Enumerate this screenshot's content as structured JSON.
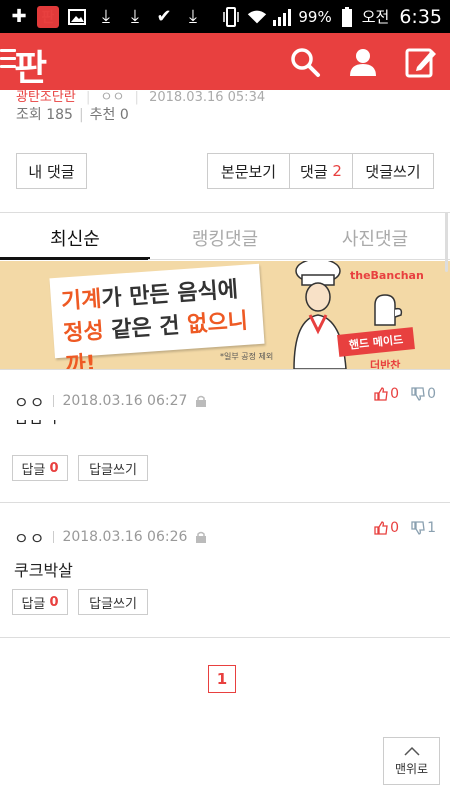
{
  "status_bar": {
    "icons": [
      "add-icon",
      "app-notification-icon",
      "image-icon",
      "download-icon",
      "download-icon",
      "check-icon",
      "download-icon",
      "phone-vibrate-icon",
      "wifi-icon",
      "signal-icon"
    ],
    "battery": "99%",
    "time_period": "오전",
    "time": "6:35"
  },
  "app_bar": {
    "logo": "판",
    "icons": [
      "search-icon",
      "profile-icon",
      "write-icon"
    ]
  },
  "post_meta": {
    "author": "광탄조단란",
    "nickname": "ㅇㅇ",
    "date": "2018.03.16 05:34",
    "views": "조회 185",
    "recommends": "추천 0"
  },
  "actions": {
    "my_comments": "내 댓글",
    "view_post": "본문보기",
    "comments_label": "댓글",
    "comments_count": "2",
    "write_comment": "댓글쓰기"
  },
  "tabs": [
    {
      "label": "최신순",
      "active": true
    },
    {
      "label": "랭킹댓글",
      "active": false
    },
    {
      "label": "사진댓글",
      "active": false
    }
  ],
  "banner": {
    "line1_a": "기계",
    "line1_b": "가 만든 음식에",
    "line2_a": "정성",
    "line2_b": " 같은 건 ",
    "line2_c": "없으니까!",
    "note": "*일부 공정 제외",
    "brand": "theBanchan",
    "tag": "핸드 메이드",
    "sub": "더반찬"
  },
  "comments": [
    {
      "nick": "ㅇㅇ",
      "date": "2018.03.16 06:27",
      "up": "0",
      "down": "0",
      "body": "ㅂㅁㄱ",
      "reply_label": "답글",
      "reply_count": "0",
      "reply_write": "답글쓰기"
    },
    {
      "nick": "ㅇㅇ",
      "date": "2018.03.16 06:26",
      "up": "0",
      "down": "1",
      "body": "쿠크박살",
      "reply_label": "답글",
      "reply_count": "0",
      "reply_write": "답글쓰기"
    }
  ],
  "pagination": {
    "current": "1"
  },
  "scroll_top": {
    "label": "맨위로"
  },
  "colors": {
    "accent": "#e8403f",
    "banner_bg": "#f3d9a6"
  }
}
